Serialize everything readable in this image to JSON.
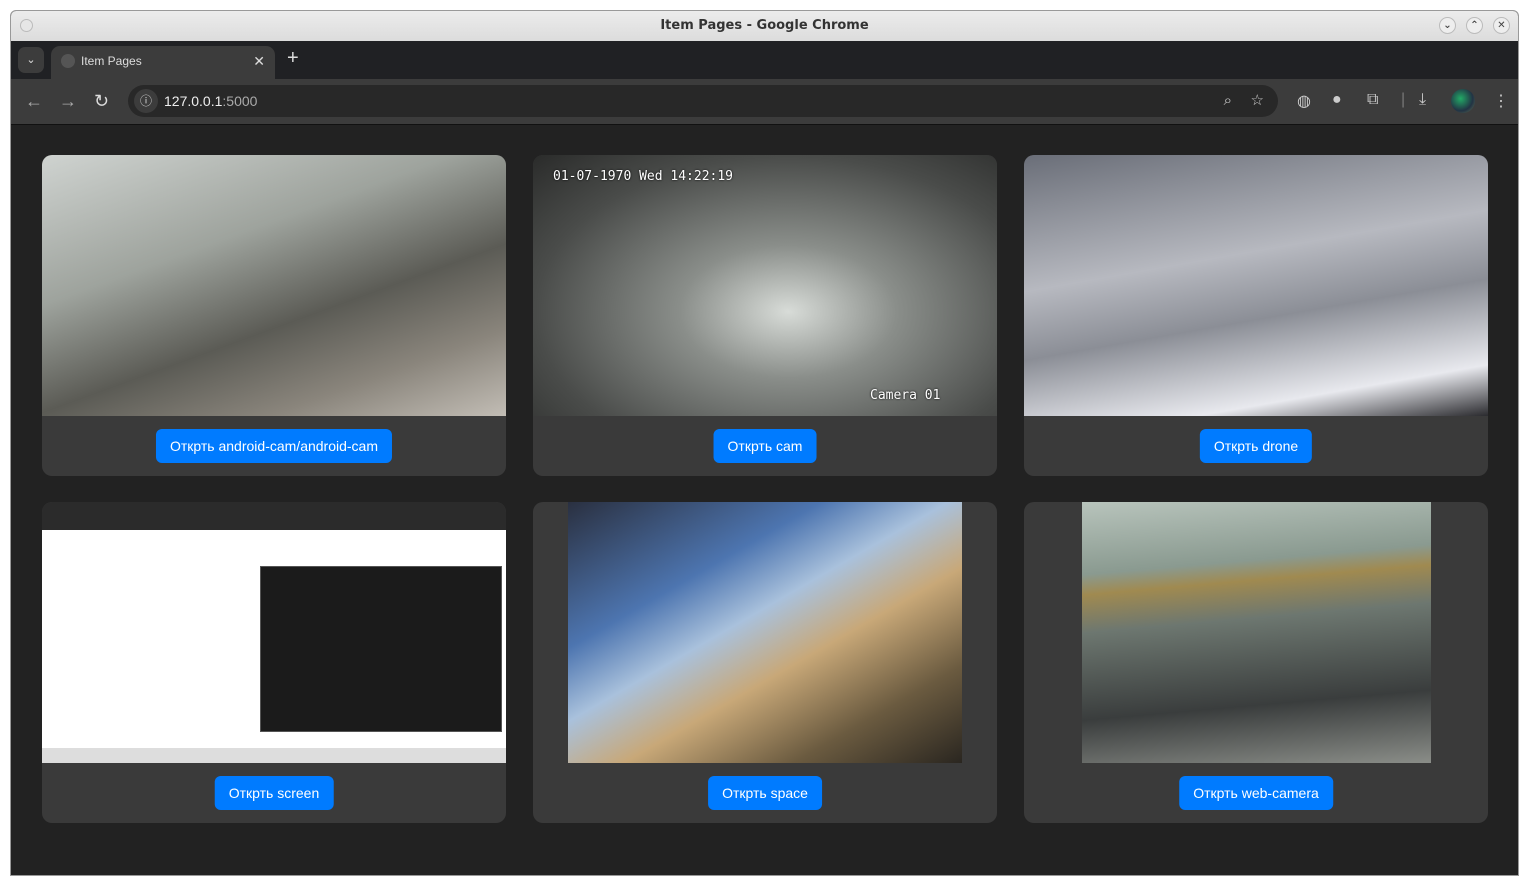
{
  "window": {
    "title": "Item Pages - Google Chrome"
  },
  "tab": {
    "label": "Item Pages"
  },
  "address": {
    "host": "127.0.0.1",
    "port": ":5000"
  },
  "colors": {
    "button": "#007bff",
    "card": "#3a3a3a",
    "page": "#222222"
  },
  "cards": [
    {
      "button": "Открть android-cam/android-cam"
    },
    {
      "button": "Открть cam",
      "overlay_time": "01-07-1970 Wed 14:22:19",
      "overlay_camera": "Camera 01"
    },
    {
      "button": "Открть drone"
    },
    {
      "button": "Открть screen"
    },
    {
      "button": "Открть space"
    },
    {
      "button": "Открть web-camera"
    }
  ]
}
